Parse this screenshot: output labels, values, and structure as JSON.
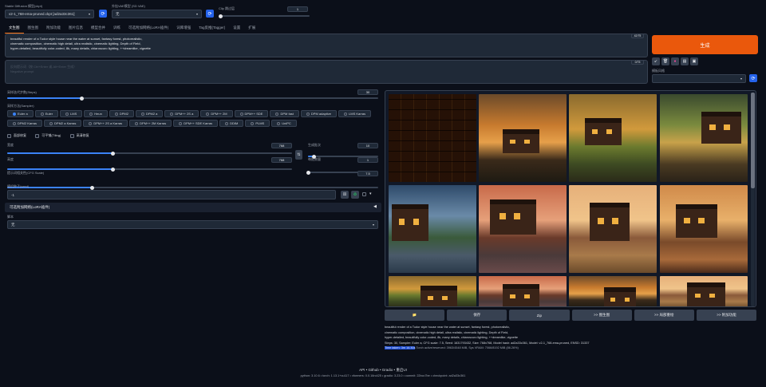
{
  "header": {
    "checkpoint_label": "Stable Diffusion 模型(ckpt)",
    "checkpoint_value": "v2-1_768-ema-pruned.ckpt [ad2a33c361]",
    "vae_label": "外挂VAE模型 (SD VAE)",
    "vae_value": "无",
    "clip_label": "Clip 跳过层",
    "clip_value": "1"
  },
  "tabs": [
    "文生图",
    "图生图",
    "附加功能",
    "图片信息",
    "模型合并",
    "训练",
    "可选附加网络(LoRA插件)",
    "词库增强",
    "Tag反推(Tagger)",
    "设置",
    "扩展"
  ],
  "prompt": {
    "text_line1": "beautiful render of a Tudor style house near the water at sunset, fantasy forest, photorealistic,",
    "text_line2": "cinematic composition, cinematic high detail, ultra realistic, cinematic lighting, Depth of Field,",
    "text_line3": "hyper-detailed, beautifully color-coded, 8k, many details, chiaroscuro lighting, ++dreamlike, vignette",
    "counter": "42/75",
    "neg_placeholder_1": "反向提示词（按 Ctrl+Enter 或 Alt+Enter 生成）",
    "neg_placeholder_2": "Negative prompt",
    "neg_counter": "0/75"
  },
  "generate": {
    "label": "生成",
    "style_label": "模板风格",
    "tool_icons": [
      "arrow-icon",
      "trash-icon",
      "palette-icon",
      "clipboard-icon",
      "save-icon"
    ]
  },
  "settings": {
    "steps_label": "采样迭代步数(Steps)",
    "steps_value": "30",
    "steps_fraction": 0.2,
    "sampler_label": "采样方法(Sampler)",
    "samplers": [
      "Euler a",
      "Euler",
      "LMS",
      "Heun",
      "DPM2",
      "DPM2 a",
      "DPM++ 2S a",
      "DPM++ 2M",
      "DPM++ SDE",
      "DPM fast",
      "DPM adaptive",
      "LMS Karras",
      "DPM2 Karras",
      "DPM2 a Karras",
      "DPM++ 2S a Karras",
      "DPM++ 2M Karras",
      "DPM++ SDE Karras",
      "DDIM",
      "PLMS",
      "UniPC"
    ],
    "sampler_selected": "Euler a",
    "checks": [
      "面部修复",
      "可平铺(Tiling)",
      "高清修复"
    ],
    "width_label": "宽度",
    "width_value": "768",
    "width_fraction": 0.37,
    "height_label": "高度",
    "height_value": "768",
    "height_fraction": 0.37,
    "swap_icon": "swap-icon",
    "batch_count_label": "生成批次",
    "batch_count_value": "10",
    "batch_count_fraction": 0.09,
    "batch_size_label": "每批数量",
    "batch_size_value": "1",
    "batch_size_fraction": 0.0,
    "cfg_label": "提示词相关性(CFG Scale)",
    "cfg_value": "7.5",
    "cfg_fraction": 0.23,
    "seed_label": "随机种子(seed)",
    "seed_value": "-1",
    "extra_label": "可选附加网络(LoRA插件)",
    "script_label": "脚本",
    "script_value": "无"
  },
  "gallery": {
    "buttons": [
      "📁",
      "保存",
      "Zip",
      ">> 图生图",
      ">> 局部重绘",
      ">> 附加功能"
    ],
    "info_line1": "beautiful render of a Tudor style house near the water at sunset, fantasy forest, photorealistic,",
    "info_line2": "cinematic composition, cinematic high detail, ultra realistic, cinematic lighting, Depth of Field,",
    "info_line3": "hyper-detailed, beautifully color-coded, 8k, many details, chiaroscuro lighting, ++dreamlike, vignette",
    "info_line4": "Steps: 30, Sampler: Euler a, CFG scale: 7.5, Seed: 1631793432, Size: 768x768, Model hash: ad2a33c361, Model: v2-1_768-ema-pruned, ENSD: 31337",
    "time_highlight": "Time taken: 3m 16.30s",
    "time_rest": "Torch active/reserved: 3963/4548 MiB, Sys VRAM: 7066/8192 MiB (86.26%)"
  },
  "footer": {
    "links": "API  •  Github  •  Gradio  •  重启UI",
    "versions": "python: 3.10.6  •  torch: 1.13.1+cu117  •  xformers: 0.0.16rc425  •  gradio: 3.23.0  •  commit: 22bcc7be  •  checkpoint: ad2a33c361"
  }
}
